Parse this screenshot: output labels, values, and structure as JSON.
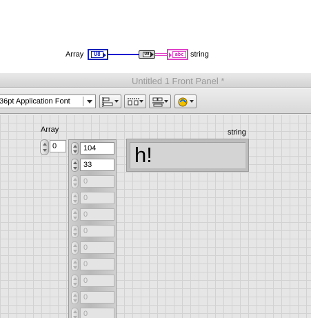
{
  "block_diagram": {
    "array_label": "Array",
    "array_terminal_text": "U8",
    "convert_node_text": "U8",
    "string_terminal_text": "abc",
    "string_label": "string",
    "colors": {
      "numeric_wire": "#1a1ad0",
      "string_wire": "#e040c8"
    }
  },
  "window": {
    "title": "Untitled 1 Front Panel *"
  },
  "toolbar": {
    "font_select": "36pt Application Font",
    "icons": [
      "align-objects-icon",
      "distribute-objects-icon",
      "resize-objects-icon",
      "reorder-icon"
    ]
  },
  "panel": {
    "array": {
      "label": "Array",
      "index": "0",
      "elements": [
        {
          "value": "104",
          "enabled": true
        },
        {
          "value": "33",
          "enabled": true
        },
        {
          "value": "0",
          "enabled": false
        },
        {
          "value": "0",
          "enabled": false
        },
        {
          "value": "0",
          "enabled": false
        },
        {
          "value": "0",
          "enabled": false
        },
        {
          "value": "0",
          "enabled": false
        },
        {
          "value": "0",
          "enabled": false
        },
        {
          "value": "0",
          "enabled": false
        },
        {
          "value": "0",
          "enabled": false
        },
        {
          "value": "0",
          "enabled": false
        }
      ]
    },
    "string": {
      "label": "string",
      "value": "h!"
    }
  }
}
